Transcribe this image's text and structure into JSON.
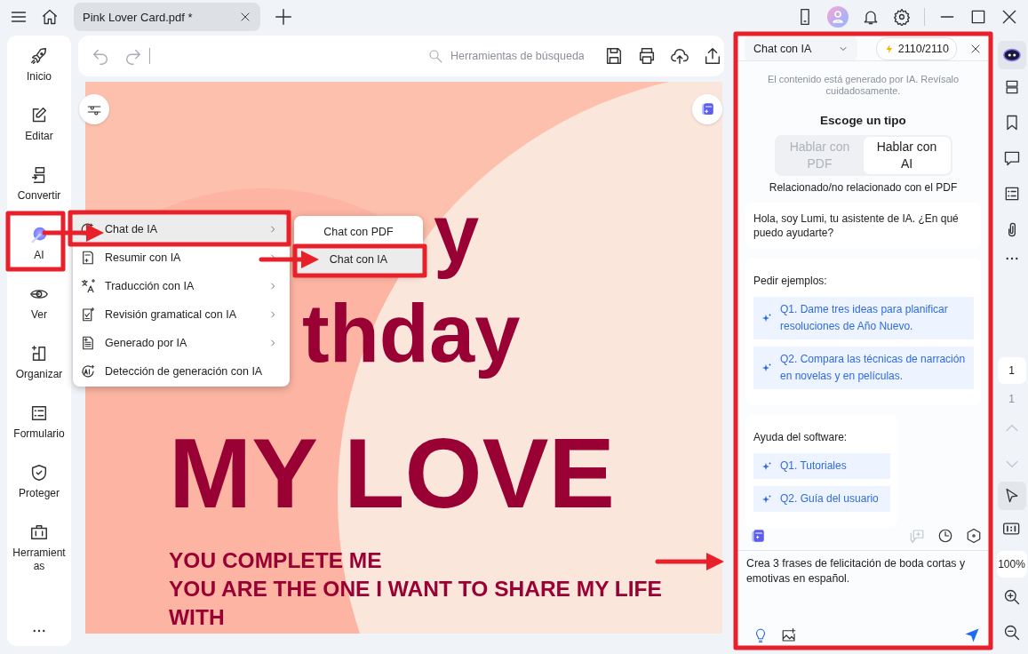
{
  "top_bar": {
    "tab": {
      "title": "Pink Lover Card.pdf *",
      "selected": true
    }
  },
  "sidebar": {
    "items": [
      {
        "label": "Inicio"
      },
      {
        "label": "Editar"
      },
      {
        "label": "Convertir"
      },
      {
        "label": "AI"
      },
      {
        "label": "Ver"
      },
      {
        "label": "Organizar"
      },
      {
        "label": "Formulario"
      },
      {
        "label": "Proteger"
      },
      {
        "label": "Herramientas"
      }
    ]
  },
  "toolbar": {
    "search": {
      "placeholder": "Herramientas de búsqueda"
    }
  },
  "document": {
    "headline_fragments": [
      "y",
      "thday"
    ],
    "title": "MY LOVE",
    "lines": [
      "YOU COMPLETE ME",
      "YOU ARE THE ONE I WANT TO SHARE MY LIFE",
      "WITH"
    ]
  },
  "context_menu": {
    "items": [
      {
        "label": "Chat de IA",
        "selected": true,
        "has_submenu": true
      },
      {
        "label": "Resumir con IA",
        "selected": false,
        "has_submenu": true
      },
      {
        "label": "Traducción con IA",
        "selected": false,
        "has_submenu": true
      },
      {
        "label": "Revisión gramatical con IA",
        "selected": false,
        "has_submenu": true
      },
      {
        "label": "Generado por IA",
        "selected": false,
        "has_submenu": true
      },
      {
        "label": "Detección de generación con IA",
        "selected": false,
        "has_submenu": false
      }
    ]
  },
  "submenu": {
    "items": [
      {
        "label": "Chat con PDF",
        "selected": false
      },
      {
        "label": "Chat con IA",
        "selected": true
      }
    ]
  },
  "chat_panel": {
    "mode_dropdown": "Chat con IA",
    "credits": "2110/2110",
    "notice": "El contenido está generado por IA. Revísalo cuidadosamente.",
    "type_heading": "Escoge un tipo",
    "type_options": [
      {
        "label": "Hablar con PDF",
        "selected": false
      },
      {
        "label": "Hablar con AI",
        "selected": true
      }
    ],
    "type_hint": "Relacionado/no relacionado con el PDF",
    "greeting": "Hola, soy Lumi, tu asistente de IA. ¿En qué puedo ayudarte?",
    "examples": {
      "heading": "Pedir ejemplos:",
      "items": [
        "Q1. Dame tres ideas para planificar resoluciones de Año Nuevo.",
        "Q2. Compara las técnicas de narración en novelas y en películas."
      ]
    },
    "help": {
      "heading": "Ayuda del software:",
      "items": [
        "Q1. Tutoriales",
        "Q2. Guía del usuario"
      ]
    },
    "input": {
      "value": "Crea 3 frases de felicitación de boda cortas y emotivas en español."
    }
  },
  "right_rail": {
    "current_page": "1",
    "total_pages": "1",
    "zoom": "100%"
  }
}
